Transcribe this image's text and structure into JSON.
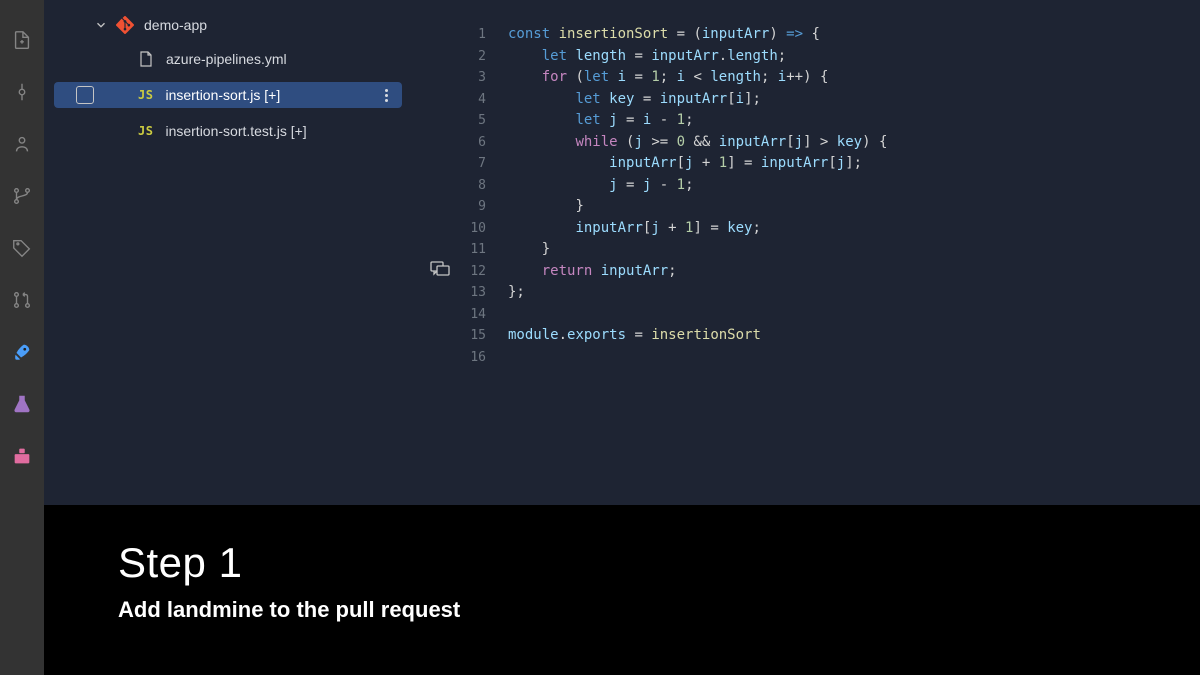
{
  "sidebar": {
    "root_label": "demo-app",
    "files": [
      {
        "icon": "doc",
        "label": "azure-pipelines.yml",
        "selected": false
      },
      {
        "icon": "js",
        "label": "insertion-sort.js [+]",
        "selected": true
      },
      {
        "icon": "js",
        "label": "insertion-sort.test.js [+]",
        "selected": false
      }
    ]
  },
  "editor": {
    "line_count": 16,
    "code": {
      "l1": {
        "indent": "",
        "t": [
          [
            "kw2",
            "const "
          ],
          [
            "fn",
            "insertionSort"
          ],
          [
            "op",
            " = ("
          ],
          [
            "var",
            "inputArr"
          ],
          [
            "op",
            ") "
          ],
          [
            "kw2",
            "=>"
          ],
          [
            "op",
            " {"
          ]
        ]
      },
      "l2": {
        "indent": "    ",
        "t": [
          [
            "kw2",
            "let "
          ],
          [
            "var",
            "length"
          ],
          [
            "op",
            " = "
          ],
          [
            "var",
            "inputArr"
          ],
          [
            "op",
            "."
          ],
          [
            "prop",
            "length"
          ],
          [
            "op",
            ";"
          ]
        ]
      },
      "l3": {
        "indent": "    ",
        "t": [
          [
            "kw",
            "for"
          ],
          [
            "op",
            " ("
          ],
          [
            "kw2",
            "let "
          ],
          [
            "var",
            "i"
          ],
          [
            "op",
            " = "
          ],
          [
            "num",
            "1"
          ],
          [
            "op",
            "; "
          ],
          [
            "var",
            "i"
          ],
          [
            "op",
            " < "
          ],
          [
            "var",
            "length"
          ],
          [
            "op",
            "; "
          ],
          [
            "var",
            "i"
          ],
          [
            "op",
            "++) {"
          ]
        ]
      },
      "l4": {
        "indent": "        ",
        "t": [
          [
            "kw2",
            "let "
          ],
          [
            "var",
            "key"
          ],
          [
            "op",
            " = "
          ],
          [
            "var",
            "inputArr"
          ],
          [
            "op",
            "["
          ],
          [
            "var",
            "i"
          ],
          [
            "op",
            "];"
          ]
        ]
      },
      "l5": {
        "indent": "        ",
        "t": [
          [
            "kw2",
            "let "
          ],
          [
            "var",
            "j"
          ],
          [
            "op",
            " = "
          ],
          [
            "var",
            "i"
          ],
          [
            "op",
            " - "
          ],
          [
            "num",
            "1"
          ],
          [
            "op",
            ";"
          ]
        ]
      },
      "l6": {
        "indent": "        ",
        "t": [
          [
            "kw",
            "while"
          ],
          [
            "op",
            " ("
          ],
          [
            "var",
            "j"
          ],
          [
            "op",
            " >= "
          ],
          [
            "num",
            "0"
          ],
          [
            "op",
            " && "
          ],
          [
            "var",
            "inputArr"
          ],
          [
            "op",
            "["
          ],
          [
            "var",
            "j"
          ],
          [
            "op",
            "] > "
          ],
          [
            "var",
            "key"
          ],
          [
            "op",
            ") {"
          ]
        ]
      },
      "l7": {
        "indent": "            ",
        "t": [
          [
            "var",
            "inputArr"
          ],
          [
            "op",
            "["
          ],
          [
            "var",
            "j"
          ],
          [
            "op",
            " + "
          ],
          [
            "num",
            "1"
          ],
          [
            "op",
            "] = "
          ],
          [
            "var",
            "inputArr"
          ],
          [
            "op",
            "["
          ],
          [
            "var",
            "j"
          ],
          [
            "op",
            "];"
          ]
        ]
      },
      "l8": {
        "indent": "            ",
        "t": [
          [
            "var",
            "j"
          ],
          [
            "op",
            " = "
          ],
          [
            "var",
            "j"
          ],
          [
            "op",
            " - "
          ],
          [
            "num",
            "1"
          ],
          [
            "op",
            ";"
          ]
        ]
      },
      "l9": {
        "indent": "        ",
        "t": [
          [
            "op",
            "}"
          ]
        ]
      },
      "l10": {
        "indent": "        ",
        "t": [
          [
            "var",
            "inputArr"
          ],
          [
            "op",
            "["
          ],
          [
            "var",
            "j"
          ],
          [
            "op",
            " + "
          ],
          [
            "num",
            "1"
          ],
          [
            "op",
            "] = "
          ],
          [
            "var",
            "key"
          ],
          [
            "op",
            ";"
          ]
        ]
      },
      "l11": {
        "indent": "    ",
        "t": [
          [
            "op",
            "}"
          ]
        ]
      },
      "l12": {
        "indent": "    ",
        "t": [
          [
            "kw",
            "return"
          ],
          [
            "op",
            " "
          ],
          [
            "var",
            "inputArr"
          ],
          [
            "op",
            ";"
          ]
        ]
      },
      "l13": {
        "indent": "",
        "t": [
          [
            "op",
            "};"
          ]
        ]
      },
      "l14": {
        "indent": "",
        "t": []
      },
      "l15": {
        "indent": "",
        "t": [
          [
            "var",
            "module"
          ],
          [
            "op",
            "."
          ],
          [
            "prop",
            "exports"
          ],
          [
            "op",
            " = "
          ],
          [
            "fn",
            "insertionSort"
          ]
        ]
      },
      "l16": {
        "indent": "",
        "t": []
      }
    }
  },
  "overlay": {
    "title": "Step 1",
    "subtitle": "Add landmine to the pull request"
  }
}
